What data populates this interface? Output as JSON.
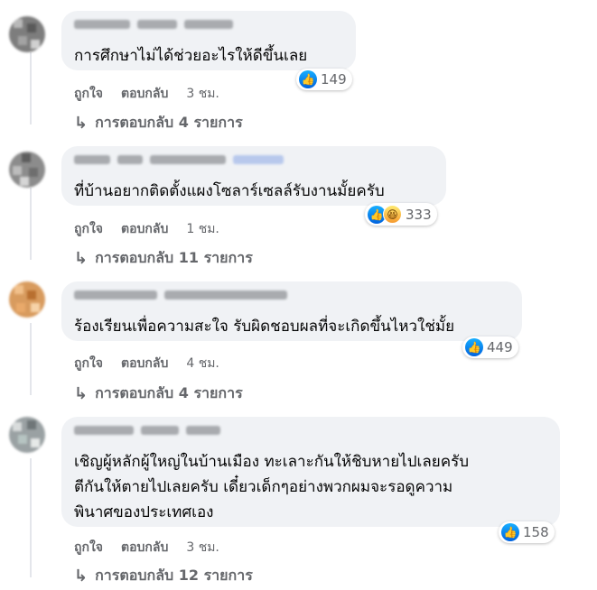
{
  "comments": [
    {
      "text": "การศึกษาไม่ได้ช่วยอะไรให้ดีขึ้นเลย",
      "reaction_count": "149",
      "reactions": [
        "like"
      ],
      "like_label": "ถูกใจ",
      "reply_label": "ตอบกลับ",
      "time": "3 ชม.",
      "view_replies": "การตอบกลับ 4 รายการ"
    },
    {
      "text": "ที่บ้านอยากติดตั้งแผงโซลาร์เซลล์รับงานมั้ยครับ",
      "reaction_count": "333",
      "reactions": [
        "like",
        "haha"
      ],
      "like_label": "ถูกใจ",
      "reply_label": "ตอบกลับ",
      "time": "1 ชม.",
      "view_replies": "การตอบกลับ 11 รายการ"
    },
    {
      "text": "ร้องเรียนเพื่อความสะใจ รับผิดชอบผลที่จะเกิดขึ้นไหวใช่มั้ย",
      "reaction_count": "449",
      "reactions": [
        "like"
      ],
      "like_label": "ถูกใจ",
      "reply_label": "ตอบกลับ",
      "time": "4 ชม.",
      "view_replies": "การตอบกลับ 4 รายการ"
    },
    {
      "text": "เชิญผู้หลักผู้ใหญ่ในบ้านเมือง ทะเลาะกันให้ชิบหายไปเลยครับ\nตีกันให้ตายไปเลยครับ เดี๋ยวเด็กๆอย่างพวกผมจะรอดูความ\nพินาศของประเทศเอง",
      "reaction_count": "158",
      "reactions": [
        "like"
      ],
      "like_label": "ถูกใจ",
      "reply_label": "ตอบกลับ",
      "time": "3 ชม.",
      "view_replies": "การตอบกลับ 12 รายการ"
    }
  ],
  "icons": {
    "like": "thumbs-up-icon",
    "haha": "laughing-face-icon",
    "reply_arrow": "reply-arrow-icon"
  },
  "colors": {
    "bubble": "#f0f2f5",
    "secondary_text": "#65676b",
    "like_blue": "#1877f2"
  }
}
